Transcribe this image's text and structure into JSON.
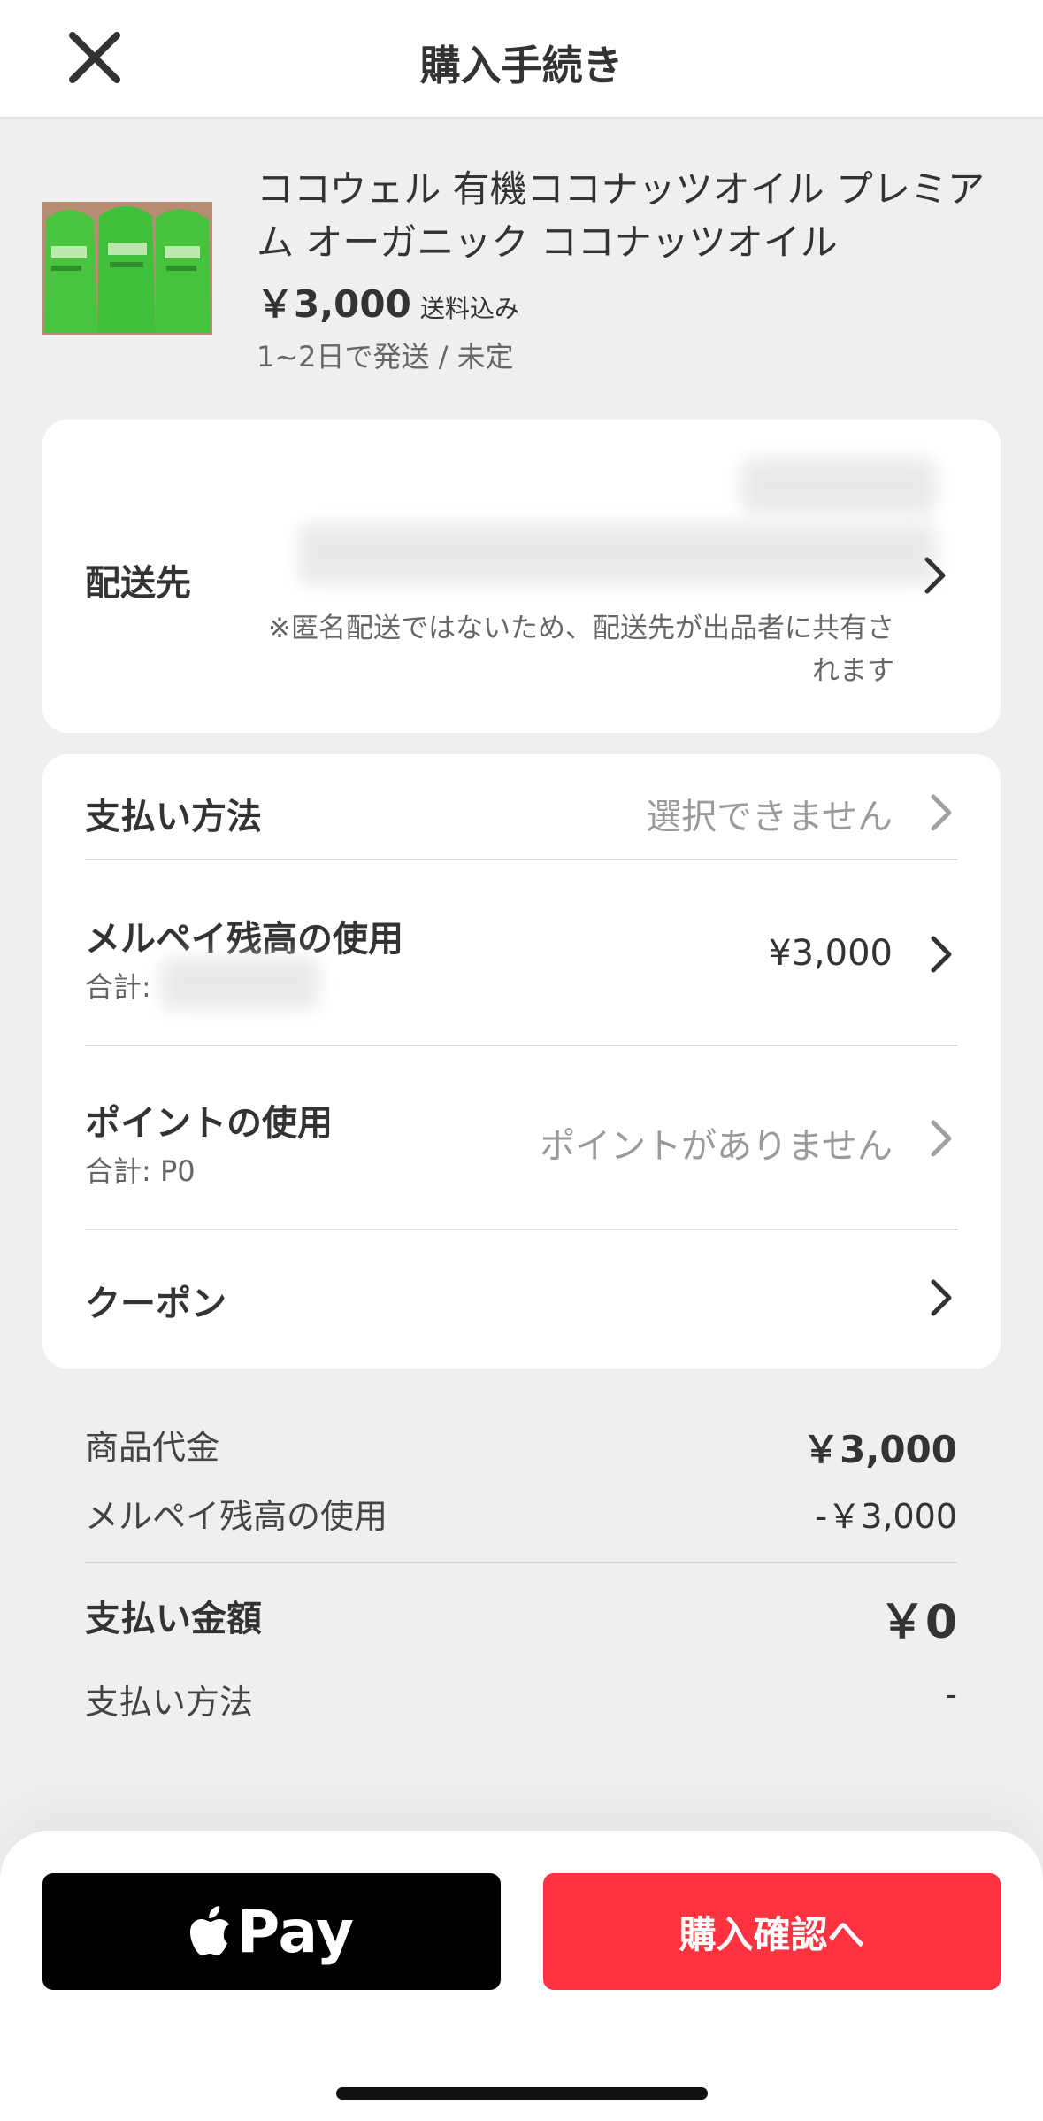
{
  "header": {
    "title": "購入手続き"
  },
  "item": {
    "title": "ココウェル 有機ココナッツオイル プレミアム オーガニック ココナッツオイル",
    "price": "￥3,000",
    "shipping_included": "送料込み",
    "delivery": "1~2日で発送 / 未定"
  },
  "address": {
    "label": "配送先",
    "note": "※匿名配送ではないため、配送先が出品者に共有されます"
  },
  "payment_rows": {
    "method": {
      "label": "支払い方法",
      "value": "選択できません"
    },
    "merpay": {
      "label": "メルペイ残高の使用",
      "sub": "合計:",
      "value": "¥3,000"
    },
    "points": {
      "label": "ポイントの使用",
      "sub": "合計: P0",
      "value": "ポイントがありません"
    },
    "coupon": {
      "label": "クーポン"
    }
  },
  "summary": {
    "item_price_label": "商品代金",
    "item_price_value": "￥3,000",
    "merpay_label": "メルペイ残高の使用",
    "merpay_value": "-￥3,000",
    "total_label": "支払い金額",
    "total_value": "￥0",
    "method_label": "支払い方法",
    "method_value": "-"
  },
  "actions": {
    "apple_pay_label": "Pay",
    "confirm_label": "購入確認へ"
  },
  "colors": {
    "accent_red": "#ff333f",
    "product_green": "#3fbf3a"
  }
}
